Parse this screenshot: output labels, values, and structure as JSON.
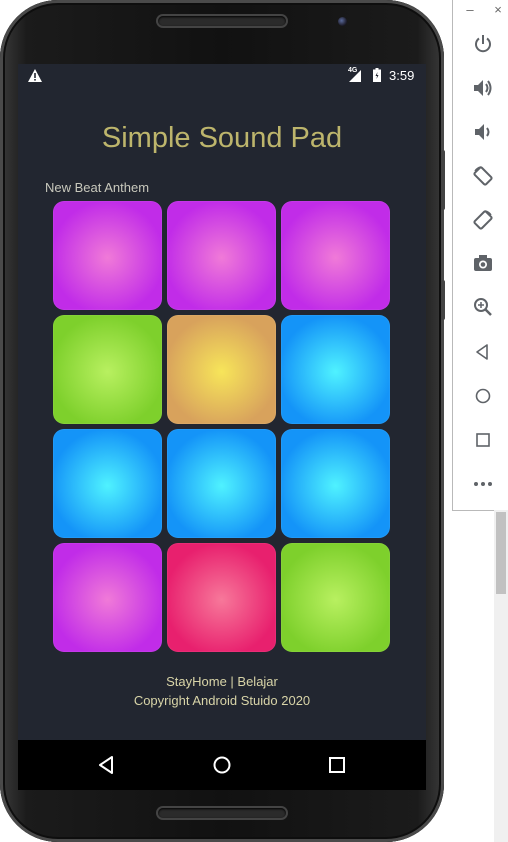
{
  "statusbar": {
    "network_label": "4G",
    "time": "3:59",
    "icons": [
      "warning-icon",
      "signal-icon",
      "battery-icon"
    ]
  },
  "app": {
    "title": "Simple Sound Pad",
    "section_label": "New Beat Anthem",
    "pads": [
      {
        "color": "purple"
      },
      {
        "color": "purple"
      },
      {
        "color": "purple"
      },
      {
        "color": "green"
      },
      {
        "color": "orange"
      },
      {
        "color": "blue"
      },
      {
        "color": "blue"
      },
      {
        "color": "blue"
      },
      {
        "color": "blue"
      },
      {
        "color": "purple"
      },
      {
        "color": "pink"
      },
      {
        "color": "green"
      }
    ],
    "footer_line1": "StayHome | Belajar",
    "footer_line2": "Copyright Android Stuido 2020"
  },
  "colors": {
    "purple": [
      "#f07ad8",
      "#c12ce8"
    ],
    "green": [
      "#b8f060",
      "#7ed02c"
    ],
    "orange": [
      "#f7e55a",
      "#d8a25c"
    ],
    "blue": [
      "#4ff2ff",
      "#1494f8"
    ],
    "pink": [
      "#f7789a",
      "#e8206e"
    ],
    "title": "#bdb56c",
    "screen_bg": "#222630"
  },
  "navbar": {
    "buttons": [
      "back-icon",
      "home-icon",
      "recents-icon"
    ]
  },
  "emulator_panel": {
    "window_buttons": {
      "minimize": "–",
      "close": "×"
    },
    "tools": [
      "power-icon",
      "volume-up-icon",
      "volume-down-icon",
      "rotate-left-icon",
      "rotate-right-icon",
      "camera-icon",
      "zoom-icon",
      "back-icon",
      "home-icon",
      "overview-icon",
      "more-icon"
    ]
  }
}
